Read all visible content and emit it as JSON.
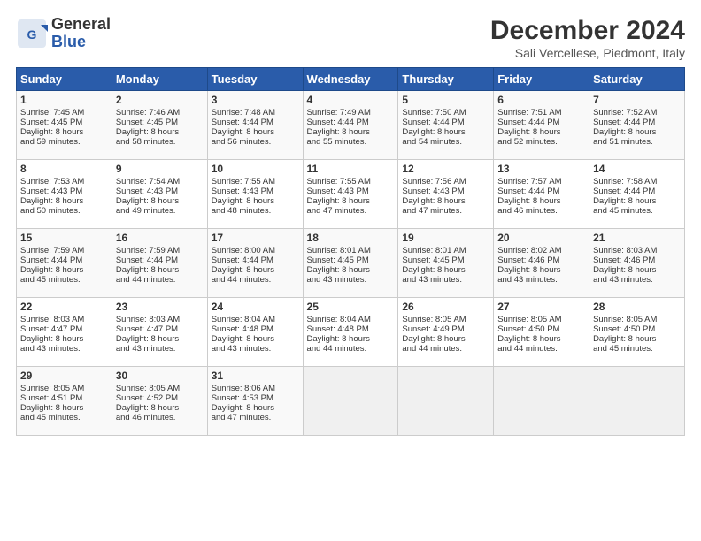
{
  "header": {
    "logo_line1": "General",
    "logo_line2": "Blue",
    "month": "December 2024",
    "location": "Sali Vercellese, Piedmont, Italy"
  },
  "weekdays": [
    "Sunday",
    "Monday",
    "Tuesday",
    "Wednesday",
    "Thursday",
    "Friday",
    "Saturday"
  ],
  "weeks": [
    [
      {
        "day": "1",
        "lines": [
          "Sunrise: 7:45 AM",
          "Sunset: 4:45 PM",
          "Daylight: 8 hours",
          "and 59 minutes."
        ]
      },
      {
        "day": "2",
        "lines": [
          "Sunrise: 7:46 AM",
          "Sunset: 4:45 PM",
          "Daylight: 8 hours",
          "and 58 minutes."
        ]
      },
      {
        "day": "3",
        "lines": [
          "Sunrise: 7:48 AM",
          "Sunset: 4:44 PM",
          "Daylight: 8 hours",
          "and 56 minutes."
        ]
      },
      {
        "day": "4",
        "lines": [
          "Sunrise: 7:49 AM",
          "Sunset: 4:44 PM",
          "Daylight: 8 hours",
          "and 55 minutes."
        ]
      },
      {
        "day": "5",
        "lines": [
          "Sunrise: 7:50 AM",
          "Sunset: 4:44 PM",
          "Daylight: 8 hours",
          "and 54 minutes."
        ]
      },
      {
        "day": "6",
        "lines": [
          "Sunrise: 7:51 AM",
          "Sunset: 4:44 PM",
          "Daylight: 8 hours",
          "and 52 minutes."
        ]
      },
      {
        "day": "7",
        "lines": [
          "Sunrise: 7:52 AM",
          "Sunset: 4:44 PM",
          "Daylight: 8 hours",
          "and 51 minutes."
        ]
      }
    ],
    [
      {
        "day": "8",
        "lines": [
          "Sunrise: 7:53 AM",
          "Sunset: 4:43 PM",
          "Daylight: 8 hours",
          "and 50 minutes."
        ]
      },
      {
        "day": "9",
        "lines": [
          "Sunrise: 7:54 AM",
          "Sunset: 4:43 PM",
          "Daylight: 8 hours",
          "and 49 minutes."
        ]
      },
      {
        "day": "10",
        "lines": [
          "Sunrise: 7:55 AM",
          "Sunset: 4:43 PM",
          "Daylight: 8 hours",
          "and 48 minutes."
        ]
      },
      {
        "day": "11",
        "lines": [
          "Sunrise: 7:55 AM",
          "Sunset: 4:43 PM",
          "Daylight: 8 hours",
          "and 47 minutes."
        ]
      },
      {
        "day": "12",
        "lines": [
          "Sunrise: 7:56 AM",
          "Sunset: 4:43 PM",
          "Daylight: 8 hours",
          "and 47 minutes."
        ]
      },
      {
        "day": "13",
        "lines": [
          "Sunrise: 7:57 AM",
          "Sunset: 4:44 PM",
          "Daylight: 8 hours",
          "and 46 minutes."
        ]
      },
      {
        "day": "14",
        "lines": [
          "Sunrise: 7:58 AM",
          "Sunset: 4:44 PM",
          "Daylight: 8 hours",
          "and 45 minutes."
        ]
      }
    ],
    [
      {
        "day": "15",
        "lines": [
          "Sunrise: 7:59 AM",
          "Sunset: 4:44 PM",
          "Daylight: 8 hours",
          "and 45 minutes."
        ]
      },
      {
        "day": "16",
        "lines": [
          "Sunrise: 7:59 AM",
          "Sunset: 4:44 PM",
          "Daylight: 8 hours",
          "and 44 minutes."
        ]
      },
      {
        "day": "17",
        "lines": [
          "Sunrise: 8:00 AM",
          "Sunset: 4:44 PM",
          "Daylight: 8 hours",
          "and 44 minutes."
        ]
      },
      {
        "day": "18",
        "lines": [
          "Sunrise: 8:01 AM",
          "Sunset: 4:45 PM",
          "Daylight: 8 hours",
          "and 43 minutes."
        ]
      },
      {
        "day": "19",
        "lines": [
          "Sunrise: 8:01 AM",
          "Sunset: 4:45 PM",
          "Daylight: 8 hours",
          "and 43 minutes."
        ]
      },
      {
        "day": "20",
        "lines": [
          "Sunrise: 8:02 AM",
          "Sunset: 4:46 PM",
          "Daylight: 8 hours",
          "and 43 minutes."
        ]
      },
      {
        "day": "21",
        "lines": [
          "Sunrise: 8:03 AM",
          "Sunset: 4:46 PM",
          "Daylight: 8 hours",
          "and 43 minutes."
        ]
      }
    ],
    [
      {
        "day": "22",
        "lines": [
          "Sunrise: 8:03 AM",
          "Sunset: 4:47 PM",
          "Daylight: 8 hours",
          "and 43 minutes."
        ]
      },
      {
        "day": "23",
        "lines": [
          "Sunrise: 8:03 AM",
          "Sunset: 4:47 PM",
          "Daylight: 8 hours",
          "and 43 minutes."
        ]
      },
      {
        "day": "24",
        "lines": [
          "Sunrise: 8:04 AM",
          "Sunset: 4:48 PM",
          "Daylight: 8 hours",
          "and 43 minutes."
        ]
      },
      {
        "day": "25",
        "lines": [
          "Sunrise: 8:04 AM",
          "Sunset: 4:48 PM",
          "Daylight: 8 hours",
          "and 44 minutes."
        ]
      },
      {
        "day": "26",
        "lines": [
          "Sunrise: 8:05 AM",
          "Sunset: 4:49 PM",
          "Daylight: 8 hours",
          "and 44 minutes."
        ]
      },
      {
        "day": "27",
        "lines": [
          "Sunrise: 8:05 AM",
          "Sunset: 4:50 PM",
          "Daylight: 8 hours",
          "and 44 minutes."
        ]
      },
      {
        "day": "28",
        "lines": [
          "Sunrise: 8:05 AM",
          "Sunset: 4:50 PM",
          "Daylight: 8 hours",
          "and 45 minutes."
        ]
      }
    ],
    [
      {
        "day": "29",
        "lines": [
          "Sunrise: 8:05 AM",
          "Sunset: 4:51 PM",
          "Daylight: 8 hours",
          "and 45 minutes."
        ]
      },
      {
        "day": "30",
        "lines": [
          "Sunrise: 8:05 AM",
          "Sunset: 4:52 PM",
          "Daylight: 8 hours",
          "and 46 minutes."
        ]
      },
      {
        "day": "31",
        "lines": [
          "Sunrise: 8:06 AM",
          "Sunset: 4:53 PM",
          "Daylight: 8 hours",
          "and 47 minutes."
        ]
      },
      null,
      null,
      null,
      null
    ]
  ]
}
